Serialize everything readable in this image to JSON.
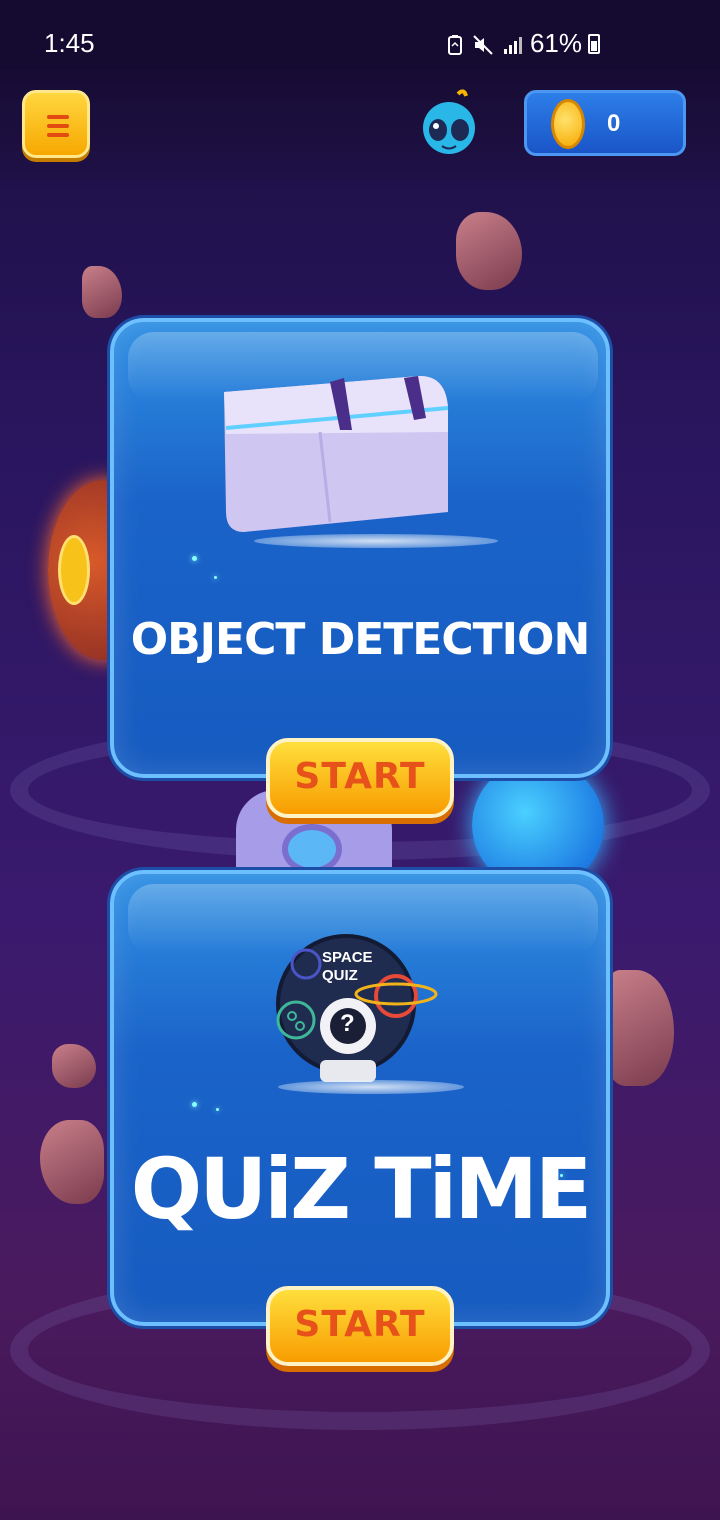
{
  "status_bar": {
    "time": "1:45",
    "battery": "61%"
  },
  "header": {
    "menu_icon": "menu-icon",
    "avatar_icon": "alien-avatar-icon",
    "coin_icon": "coin-icon",
    "coins": "0"
  },
  "cards": [
    {
      "title": "OBJECT DETECTION",
      "icon": "treasure-chest-icon",
      "button_label": "START"
    },
    {
      "title": "QUiZ TiME",
      "icon": "space-quiz-badge-icon",
      "badge_text_line1": "SPACE",
      "badge_text_line2": "QUIZ",
      "badge_symbol": "?",
      "button_label": "START"
    }
  ],
  "colors": {
    "accent_orange": "#f89c00",
    "card_blue": "#1a63c9",
    "button_text": "#e6521a"
  }
}
